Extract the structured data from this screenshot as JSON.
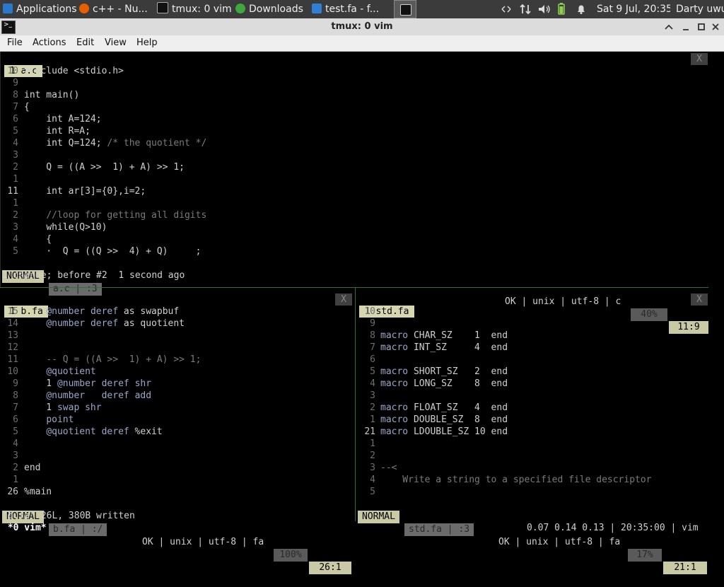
{
  "taskbar": {
    "applications": "Applications",
    "apps": [
      {
        "label": "c++ - Nu..."
      },
      {
        "label": "tmux: 0 vim"
      },
      {
        "label": "Downloads"
      },
      {
        "label": "test.fa - f..."
      }
    ],
    "clock": "Sat  9 Jul, 20:35",
    "user": "Darty uwu",
    "colors": {
      "firefox": "#e66000",
      "downloads": "#3fa73f",
      "vscode": "#2f7fd4"
    }
  },
  "window": {
    "title": "tmux: 0 vim",
    "menu": [
      "File",
      "Actions",
      "Edit",
      "View",
      "Help"
    ]
  },
  "top_pane": {
    "tab_num": "1",
    "tab_name": "a.c",
    "close": "X",
    "lines": [
      {
        "n": "10",
        "t": "#include <stdio.h>"
      },
      {
        "n": "9",
        "t": ""
      },
      {
        "n": "8",
        "t": "int main()"
      },
      {
        "n": "7",
        "t": "{"
      },
      {
        "n": "6",
        "t": "    int A=124;"
      },
      {
        "n": "5",
        "t": "    int R=A;"
      },
      {
        "n": "4",
        "t": "    int Q=124; /* the quotient */"
      },
      {
        "n": "3",
        "t": ""
      },
      {
        "n": "2",
        "t": "    Q = ((A >>  1) + A) >> 1;"
      },
      {
        "n": "1",
        "t": ""
      },
      {
        "n": "11",
        "t": "    int ar[3]={0},i=2;"
      },
      {
        "n": "1",
        "t": ""
      },
      {
        "n": "2",
        "t": "    //loop for getting all digits"
      },
      {
        "n": "3",
        "t": "    while(Q>10)"
      },
      {
        "n": "4",
        "t": "    {"
      },
      {
        "n": "5",
        "t": "    ·  Q = ((Q >>  4) + Q)     ;"
      }
    ],
    "status": {
      "mode": "NORMAL",
      "file": "a.c | :3",
      "info": "OK | unix | utf-8 | c",
      "pct": "40%",
      "pos": "11:9"
    },
    "message": "1 change; before #2  1 second ago"
  },
  "left_pane": {
    "tab_num": "1",
    "tab_name": "b.fa",
    "close": "X",
    "lines": [
      {
        "n": "15",
        "t": "    @number deref as swapbuf"
      },
      {
        "n": "14",
        "t": "    @number deref as quotient"
      },
      {
        "n": "13",
        "t": ""
      },
      {
        "n": "12",
        "t": ""
      },
      {
        "n": "11",
        "t": "    -- Q = ((A >>  1) + A) >> 1;"
      },
      {
        "n": "10",
        "t": "    @quotient"
      },
      {
        "n": "9",
        "t": "    1 @number deref shr"
      },
      {
        "n": "8",
        "t": "    @number   deref add"
      },
      {
        "n": "7",
        "t": "    1 swap shr"
      },
      {
        "n": "6",
        "t": "    point"
      },
      {
        "n": "5",
        "t": "    @quotient deref %exit"
      },
      {
        "n": "4",
        "t": ""
      },
      {
        "n": "3",
        "t": ""
      },
      {
        "n": "2",
        "t": "end"
      },
      {
        "n": "1",
        "t": ""
      },
      {
        "n": "26",
        "t": "%main"
      }
    ],
    "status": {
      "mode": "NORMAL",
      "file": "b.fa | :/",
      "info": "OK | unix | utf-8 | fa",
      "pct": "100%",
      "pos": "26:1"
    },
    "message": "\"b.fa\" 26L, 380B written"
  },
  "right_pane": {
    "tab_num": "1",
    "tab_name": "std.fa",
    "close": "X",
    "lines": [
      {
        "n": "10",
        "t": ""
      },
      {
        "n": "9",
        "t": ""
      },
      {
        "n": "8",
        "t": "macro CHAR_SZ    1  end"
      },
      {
        "n": "7",
        "t": "macro INT_SZ     4  end"
      },
      {
        "n": "6",
        "t": ""
      },
      {
        "n": "5",
        "t": "macro SHORT_SZ   2  end"
      },
      {
        "n": "4",
        "t": "macro LONG_SZ    8  end"
      },
      {
        "n": "3",
        "t": ""
      },
      {
        "n": "2",
        "t": "macro FLOAT_SZ   4  end"
      },
      {
        "n": "1",
        "t": "macro DOUBLE_SZ  8  end"
      },
      {
        "n": "21",
        "t": "macro LDOUBLE_SZ 10 end"
      },
      {
        "n": "1",
        "t": ""
      },
      {
        "n": "2",
        "t": ""
      },
      {
        "n": "3",
        "t": "--<"
      },
      {
        "n": "4",
        "t": "    Write a string to a specified file descriptor"
      },
      {
        "n": "5",
        "t": ""
      }
    ],
    "status": {
      "mode": "NORMAL",
      "file": "std.fa | :3",
      "info": "OK | unix | utf-8 | fa",
      "pct": "17%",
      "pos": "21:1"
    }
  },
  "tmux": {
    "window": " *0 vim*",
    "right": "0.07 0.14 0.13 | 20:35:00 | vim"
  }
}
